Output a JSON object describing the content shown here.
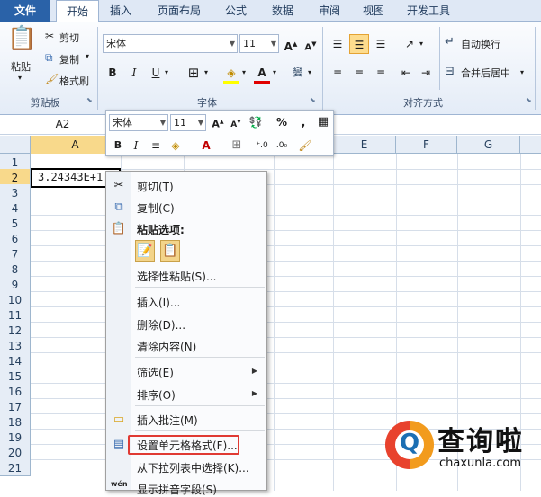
{
  "ribbon_tabs": [
    "文件",
    "开始",
    "插入",
    "页面布局",
    "公式",
    "数据",
    "审阅",
    "视图",
    "开发工具"
  ],
  "clipboard": {
    "paste": "粘贴",
    "cut": "剪切",
    "copy": "复制",
    "format_painter": "格式刷",
    "group": "剪贴板"
  },
  "font": {
    "name": "宋体",
    "size": "11",
    "bold": "B",
    "italic": "I",
    "underline": "U",
    "group": "字体"
  },
  "alignment": {
    "wrap": "自动换行",
    "merge": "合并后居中",
    "group": "对齐方式"
  },
  "formula_bar": {
    "name_box": "A2"
  },
  "columns": [
    "A",
    "B",
    "C",
    "D",
    "E",
    "F",
    "G"
  ],
  "rows": [
    "1",
    "2",
    "3",
    "4",
    "5",
    "6",
    "7",
    "8",
    "9",
    "10",
    "11",
    "12",
    "13",
    "14",
    "15",
    "16",
    "17",
    "18",
    "19",
    "20",
    "21"
  ],
  "cell_a2": "3.24343E+1",
  "mini_toolbar": {
    "font": "宋体",
    "size": "11",
    "percent": "%",
    "comma": ","
  },
  "context_menu": {
    "cut": "剪切(T)",
    "copy": "复制(C)",
    "paste_options": "粘贴选项:",
    "paste_special": "选择性粘贴(S)...",
    "insert": "插入(I)...",
    "delete": "删除(D)...",
    "clear": "清除内容(N)",
    "filter": "筛选(E)",
    "sort": "排序(O)",
    "insert_comment": "插入批注(M)",
    "format_cells": "设置单元格格式(F)...",
    "pick_list": "从下拉列表中选择(K)...",
    "phonetic": "显示拼音字段(S)"
  },
  "watermark": {
    "brand": "查询啦",
    "url": "chaxunla.com",
    "logo_letter": "Q"
  },
  "colors": {
    "accent": "#2a62a8",
    "selection": "#f8d98b",
    "highlight_box": "#e03a33"
  }
}
